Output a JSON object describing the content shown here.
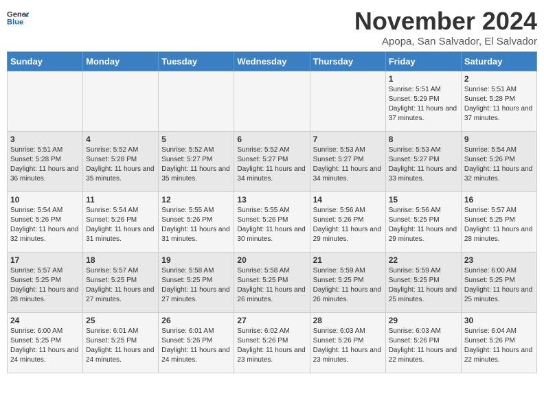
{
  "logo": {
    "line1": "General",
    "line2": "Blue"
  },
  "title": "November 2024",
  "subtitle": "Apopa, San Salvador, El Salvador",
  "weekdays": [
    "Sunday",
    "Monday",
    "Tuesday",
    "Wednesday",
    "Thursday",
    "Friday",
    "Saturday"
  ],
  "rows": [
    [
      {
        "day": "",
        "sunrise": "",
        "sunset": "",
        "daylight": ""
      },
      {
        "day": "",
        "sunrise": "",
        "sunset": "",
        "daylight": ""
      },
      {
        "day": "",
        "sunrise": "",
        "sunset": "",
        "daylight": ""
      },
      {
        "day": "",
        "sunrise": "",
        "sunset": "",
        "daylight": ""
      },
      {
        "day": "",
        "sunrise": "",
        "sunset": "",
        "daylight": ""
      },
      {
        "day": "1",
        "sunrise": "Sunrise: 5:51 AM",
        "sunset": "Sunset: 5:29 PM",
        "daylight": "Daylight: 11 hours and 37 minutes."
      },
      {
        "day": "2",
        "sunrise": "Sunrise: 5:51 AM",
        "sunset": "Sunset: 5:28 PM",
        "daylight": "Daylight: 11 hours and 37 minutes."
      }
    ],
    [
      {
        "day": "3",
        "sunrise": "Sunrise: 5:51 AM",
        "sunset": "Sunset: 5:28 PM",
        "daylight": "Daylight: 11 hours and 36 minutes."
      },
      {
        "day": "4",
        "sunrise": "Sunrise: 5:52 AM",
        "sunset": "Sunset: 5:28 PM",
        "daylight": "Daylight: 11 hours and 35 minutes."
      },
      {
        "day": "5",
        "sunrise": "Sunrise: 5:52 AM",
        "sunset": "Sunset: 5:27 PM",
        "daylight": "Daylight: 11 hours and 35 minutes."
      },
      {
        "day": "6",
        "sunrise": "Sunrise: 5:52 AM",
        "sunset": "Sunset: 5:27 PM",
        "daylight": "Daylight: 11 hours and 34 minutes."
      },
      {
        "day": "7",
        "sunrise": "Sunrise: 5:53 AM",
        "sunset": "Sunset: 5:27 PM",
        "daylight": "Daylight: 11 hours and 34 minutes."
      },
      {
        "day": "8",
        "sunrise": "Sunrise: 5:53 AM",
        "sunset": "Sunset: 5:27 PM",
        "daylight": "Daylight: 11 hours and 33 minutes."
      },
      {
        "day": "9",
        "sunrise": "Sunrise: 5:54 AM",
        "sunset": "Sunset: 5:26 PM",
        "daylight": "Daylight: 11 hours and 32 minutes."
      }
    ],
    [
      {
        "day": "10",
        "sunrise": "Sunrise: 5:54 AM",
        "sunset": "Sunset: 5:26 PM",
        "daylight": "Daylight: 11 hours and 32 minutes."
      },
      {
        "day": "11",
        "sunrise": "Sunrise: 5:54 AM",
        "sunset": "Sunset: 5:26 PM",
        "daylight": "Daylight: 11 hours and 31 minutes."
      },
      {
        "day": "12",
        "sunrise": "Sunrise: 5:55 AM",
        "sunset": "Sunset: 5:26 PM",
        "daylight": "Daylight: 11 hours and 31 minutes."
      },
      {
        "day": "13",
        "sunrise": "Sunrise: 5:55 AM",
        "sunset": "Sunset: 5:26 PM",
        "daylight": "Daylight: 11 hours and 30 minutes."
      },
      {
        "day": "14",
        "sunrise": "Sunrise: 5:56 AM",
        "sunset": "Sunset: 5:26 PM",
        "daylight": "Daylight: 11 hours and 29 minutes."
      },
      {
        "day": "15",
        "sunrise": "Sunrise: 5:56 AM",
        "sunset": "Sunset: 5:25 PM",
        "daylight": "Daylight: 11 hours and 29 minutes."
      },
      {
        "day": "16",
        "sunrise": "Sunrise: 5:57 AM",
        "sunset": "Sunset: 5:25 PM",
        "daylight": "Daylight: 11 hours and 28 minutes."
      }
    ],
    [
      {
        "day": "17",
        "sunrise": "Sunrise: 5:57 AM",
        "sunset": "Sunset: 5:25 PM",
        "daylight": "Daylight: 11 hours and 28 minutes."
      },
      {
        "day": "18",
        "sunrise": "Sunrise: 5:57 AM",
        "sunset": "Sunset: 5:25 PM",
        "daylight": "Daylight: 11 hours and 27 minutes."
      },
      {
        "day": "19",
        "sunrise": "Sunrise: 5:58 AM",
        "sunset": "Sunset: 5:25 PM",
        "daylight": "Daylight: 11 hours and 27 minutes."
      },
      {
        "day": "20",
        "sunrise": "Sunrise: 5:58 AM",
        "sunset": "Sunset: 5:25 PM",
        "daylight": "Daylight: 11 hours and 26 minutes."
      },
      {
        "day": "21",
        "sunrise": "Sunrise: 5:59 AM",
        "sunset": "Sunset: 5:25 PM",
        "daylight": "Daylight: 11 hours and 26 minutes."
      },
      {
        "day": "22",
        "sunrise": "Sunrise: 5:59 AM",
        "sunset": "Sunset: 5:25 PM",
        "daylight": "Daylight: 11 hours and 25 minutes."
      },
      {
        "day": "23",
        "sunrise": "Sunrise: 6:00 AM",
        "sunset": "Sunset: 5:25 PM",
        "daylight": "Daylight: 11 hours and 25 minutes."
      }
    ],
    [
      {
        "day": "24",
        "sunrise": "Sunrise: 6:00 AM",
        "sunset": "Sunset: 5:25 PM",
        "daylight": "Daylight: 11 hours and 24 minutes."
      },
      {
        "day": "25",
        "sunrise": "Sunrise: 6:01 AM",
        "sunset": "Sunset: 5:25 PM",
        "daylight": "Daylight: 11 hours and 24 minutes."
      },
      {
        "day": "26",
        "sunrise": "Sunrise: 6:01 AM",
        "sunset": "Sunset: 5:26 PM",
        "daylight": "Daylight: 11 hours and 24 minutes."
      },
      {
        "day": "27",
        "sunrise": "Sunrise: 6:02 AM",
        "sunset": "Sunset: 5:26 PM",
        "daylight": "Daylight: 11 hours and 23 minutes."
      },
      {
        "day": "28",
        "sunrise": "Sunrise: 6:03 AM",
        "sunset": "Sunset: 5:26 PM",
        "daylight": "Daylight: 11 hours and 23 minutes."
      },
      {
        "day": "29",
        "sunrise": "Sunrise: 6:03 AM",
        "sunset": "Sunset: 5:26 PM",
        "daylight": "Daylight: 11 hours and 22 minutes."
      },
      {
        "day": "30",
        "sunrise": "Sunrise: 6:04 AM",
        "sunset": "Sunset: 5:26 PM",
        "daylight": "Daylight: 11 hours and 22 minutes."
      }
    ]
  ]
}
